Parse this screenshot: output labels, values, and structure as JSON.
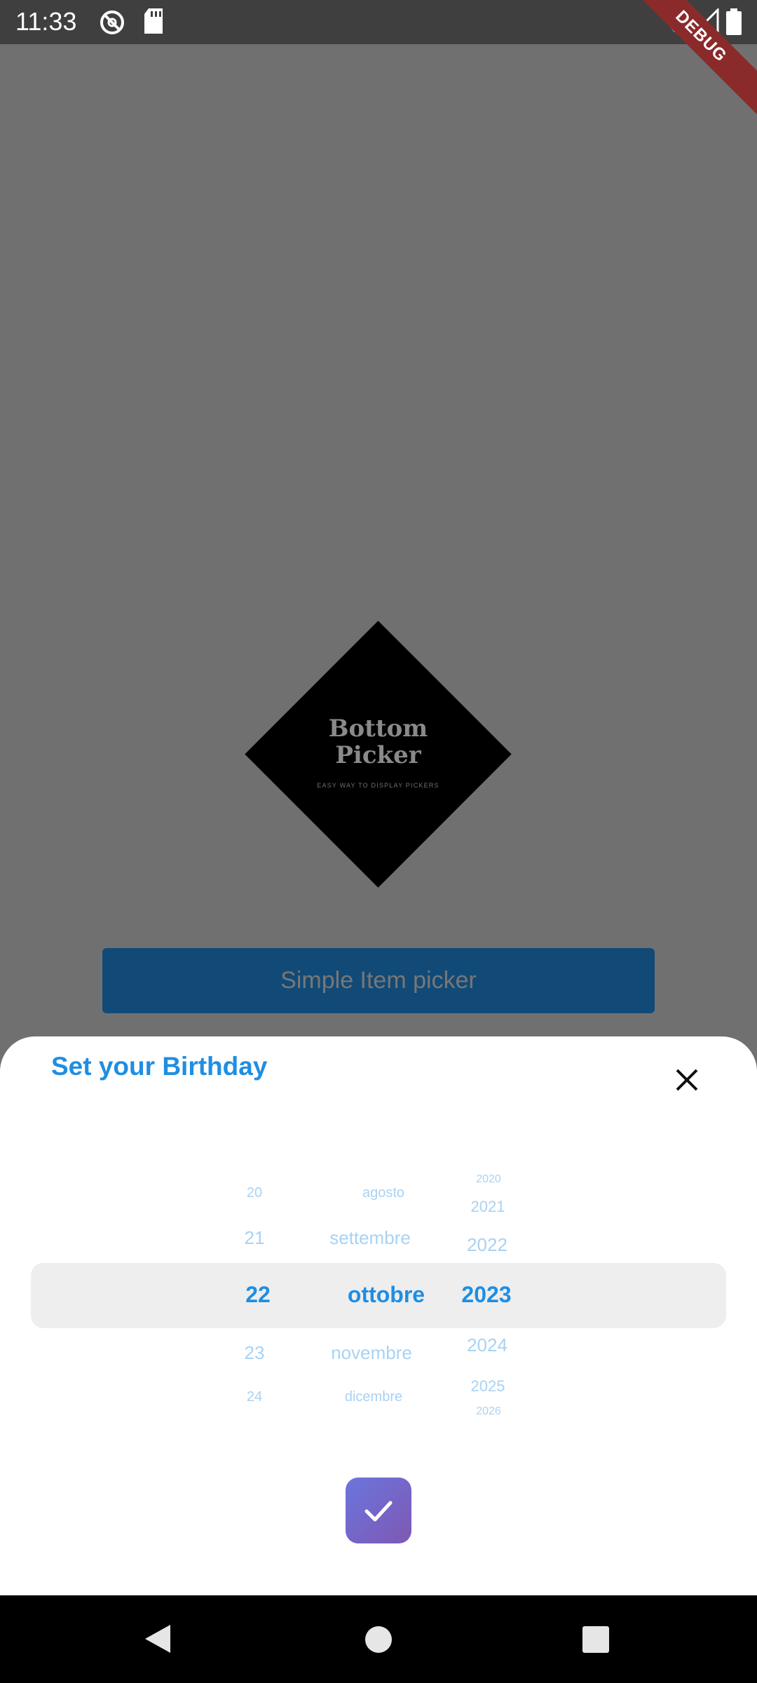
{
  "status_bar": {
    "time": "11:33",
    "icons": [
      "at-sign-icon",
      "sd-card-icon",
      "wifi-icon",
      "cellular-signal-icon",
      "battery-icon"
    ],
    "debug_banner": "DEBUG"
  },
  "logo": {
    "title_line1": "Bottom",
    "title_line2": "Picker",
    "tagline": "EASY WAY TO DISPLAY PICKERS"
  },
  "background": {
    "item_picker_button": "Simple Item picker"
  },
  "bottom_sheet": {
    "title": "Set your Birthday",
    "close_icon": "close-icon",
    "day_wheel": {
      "visible_items": [
        "20",
        "21",
        "22",
        "23",
        "24"
      ],
      "selected": "22"
    },
    "month_wheel": {
      "visible_items": [
        "agosto",
        "settembre",
        "ottobre",
        "novembre",
        "dicembre"
      ],
      "selected": "ottobre"
    },
    "year_wheel": {
      "visible_items": [
        "2020",
        "2021",
        "2022",
        "2023",
        "2024",
        "2025",
        "2026"
      ],
      "selected": "2023"
    },
    "confirm_icon": "check-icon"
  },
  "nav_bar": {
    "icons": [
      "back-icon",
      "home-icon",
      "recents-icon"
    ]
  },
  "colors": {
    "accent": "#1f8ee3",
    "scrim": "#717071",
    "button_gradient_start": "#6a75de",
    "button_gradient_end": "#7f58b2"
  }
}
